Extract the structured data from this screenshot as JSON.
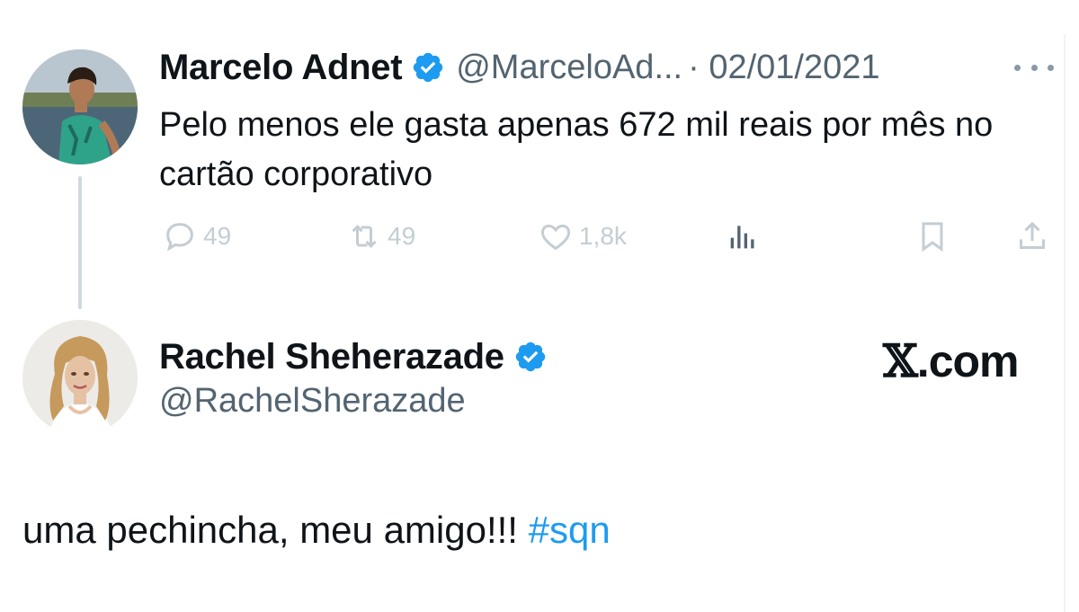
{
  "tweet1": {
    "author_name": "Marcelo Adnet",
    "handle": "@MarceloAd...",
    "date": "· 02/01/2021",
    "text": "Pelo menos ele gasta apenas 672 mil reais por mês no cartão corporativo",
    "actions": {
      "replies": "49",
      "retweets": "49",
      "likes": "1,8k"
    },
    "icons": [
      "verified-badge-icon",
      "more-icon",
      "reply-icon",
      "retweet-icon",
      "like-icon",
      "views-icon",
      "bookmark-icon",
      "share-icon"
    ]
  },
  "tweet2": {
    "author_name": "Rachel Sheherazade",
    "handle": "@RachelSherazade",
    "text": "uma pechincha, meu amigo!!! ",
    "hashtag": "#sqn"
  },
  "watermark": {
    "logo": "𝕏",
    "text": ".com"
  },
  "colors": {
    "text_primary": "#0f1419",
    "text_secondary": "#536471",
    "accent": "#1d9bf0",
    "action_icons": "#c4cdd3",
    "thread_line": "#cfd9de"
  }
}
